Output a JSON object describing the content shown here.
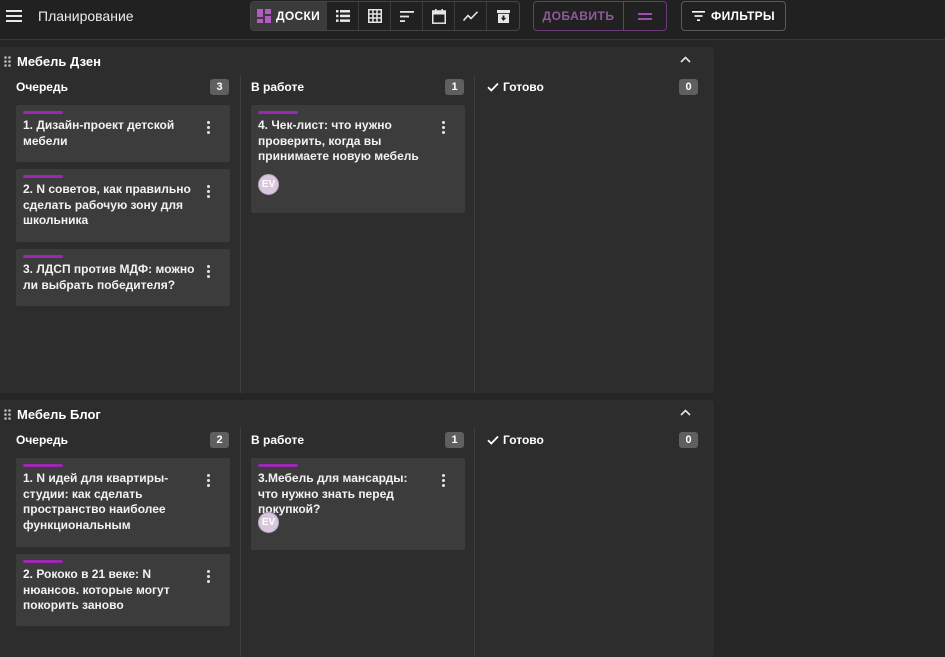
{
  "app": {
    "title": "Планирование"
  },
  "toolbar": {
    "views": [
      {
        "name": "boards",
        "label": "ДОСКИ",
        "icon": "dashboard-icon",
        "active": true
      },
      {
        "name": "list",
        "icon": "list-icon"
      },
      {
        "name": "table",
        "icon": "grid-icon"
      },
      {
        "name": "gantt",
        "icon": "sort-icon"
      },
      {
        "name": "calendar",
        "icon": "calendar-icon"
      },
      {
        "name": "chart",
        "icon": "trend-icon"
      },
      {
        "name": "archive",
        "icon": "archive-icon"
      }
    ],
    "add_label": "ДОБАВИТЬ",
    "filters_label": "ФИЛЬТРЫ"
  },
  "colors": {
    "accent": "#9c27b0",
    "card": "#3c3c3c",
    "board": "#2d2d2d",
    "background": "#262626"
  },
  "boards": [
    {
      "title": "Мебель Дзен",
      "columns": [
        {
          "title": "Очередь",
          "count": "3",
          "cards": [
            {
              "text": "1. Дизайн-проект детской мебели"
            },
            {
              "text": "2. N советов, как правильно сделать рабочую зону для школьника"
            },
            {
              "text": "3. ЛДСП против МДФ: можно ли выбрать победителя?"
            }
          ]
        },
        {
          "title": "В работе",
          "count": "1",
          "cards": [
            {
              "text": "4. Чек-лист: что нужно проверить, когда вы принимаете новую мебель",
              "avatar": "EV"
            }
          ]
        },
        {
          "title": "Готово",
          "count": "0",
          "cards": []
        }
      ]
    },
    {
      "title": "Мебель Блог",
      "columns": [
        {
          "title": "Очередь",
          "count": "2",
          "cards": [
            {
              "text": "1. N идей для квартиры-студии: как сделать пространство наиболее функциональным"
            },
            {
              "text": "2. Рококо в 21 веке: N нюансов. которые могут покорить заново"
            }
          ]
        },
        {
          "title": "В работе",
          "count": "1",
          "cards": [
            {
              "text": "3.Мебель для мансарды: что нужно знать перед покупкой?",
              "avatar": "EV"
            }
          ]
        },
        {
          "title": "Готово",
          "count": "0",
          "cards": []
        }
      ]
    }
  ]
}
